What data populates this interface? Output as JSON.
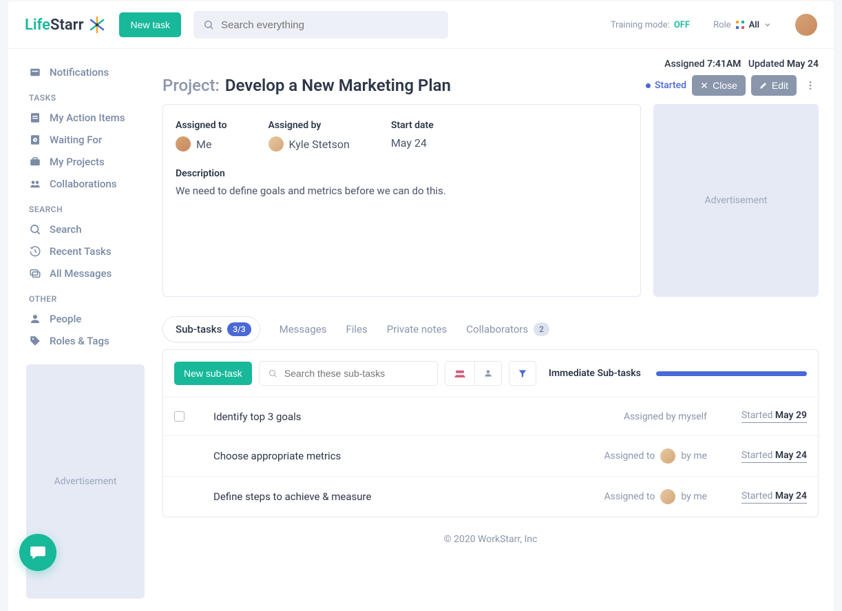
{
  "header": {
    "logo": {
      "life": "Life",
      "starr": "Starr"
    },
    "new_task": "New task",
    "search_placeholder": "Search everything",
    "training_label": "Training mode:",
    "training_value": "OFF",
    "role_label": "Role",
    "role_value": "All"
  },
  "sidebar": {
    "notifications": "Notifications",
    "tasks_header": "TASKS",
    "action_items": "My Action Items",
    "waiting_for": "Waiting For",
    "my_projects": "My Projects",
    "collaborations": "Collaborations",
    "search_header": "SEARCH",
    "search": "Search",
    "recent_tasks": "Recent Tasks",
    "all_messages": "All Messages",
    "other_header": "OTHER",
    "people": "People",
    "roles_tags": "Roles & Tags",
    "ad_label": "Advertisement"
  },
  "meta": {
    "assigned_label": "Assigned",
    "assigned_time": "7:41AM",
    "updated_label": "Updated",
    "updated_date": "May 24"
  },
  "project": {
    "prefix": "Project:",
    "title": "Develop a New Marketing Plan",
    "status": "Started",
    "close_btn": "Close",
    "edit_btn": "Edit",
    "assigned_to_label": "Assigned to",
    "assigned_to_value": "Me",
    "assigned_by_label": "Assigned by",
    "assigned_by_value": "Kyle Stetson",
    "start_date_label": "Start date",
    "start_date_value": "May 24",
    "description_label": "Description",
    "description_value": "We need to define goals and metrics before we can do this."
  },
  "ad_side": "Advertisement",
  "tabs": {
    "subtasks": "Sub-tasks",
    "subtasks_count": "3/3",
    "messages": "Messages",
    "files": "Files",
    "notes": "Private notes",
    "collaborators": "Collaborators",
    "collaborators_count": "2"
  },
  "subtasks": {
    "new_btn": "New sub-task",
    "search_placeholder": "Search these sub-tasks",
    "immediate_label": "Immediate Sub-tasks",
    "rows": [
      {
        "title": "Identify top 3 goals",
        "assigned": "Assigned by myself",
        "started_label": "Started",
        "date": "May 29",
        "has_checkbox": true,
        "has_avatar": false
      },
      {
        "title": "Choose appropriate metrics",
        "assigned_prefix": "Assigned to",
        "assigned_suffix": "by me",
        "started_label": "Started",
        "date": "May 24",
        "has_checkbox": false,
        "has_avatar": true
      },
      {
        "title": "Define steps to achieve & measure",
        "assigned_prefix": "Assigned to",
        "assigned_suffix": "by me",
        "started_label": "Started",
        "date": "May 24",
        "has_checkbox": false,
        "has_avatar": true
      }
    ]
  },
  "footer": "© 2020 WorkStarr, Inc"
}
